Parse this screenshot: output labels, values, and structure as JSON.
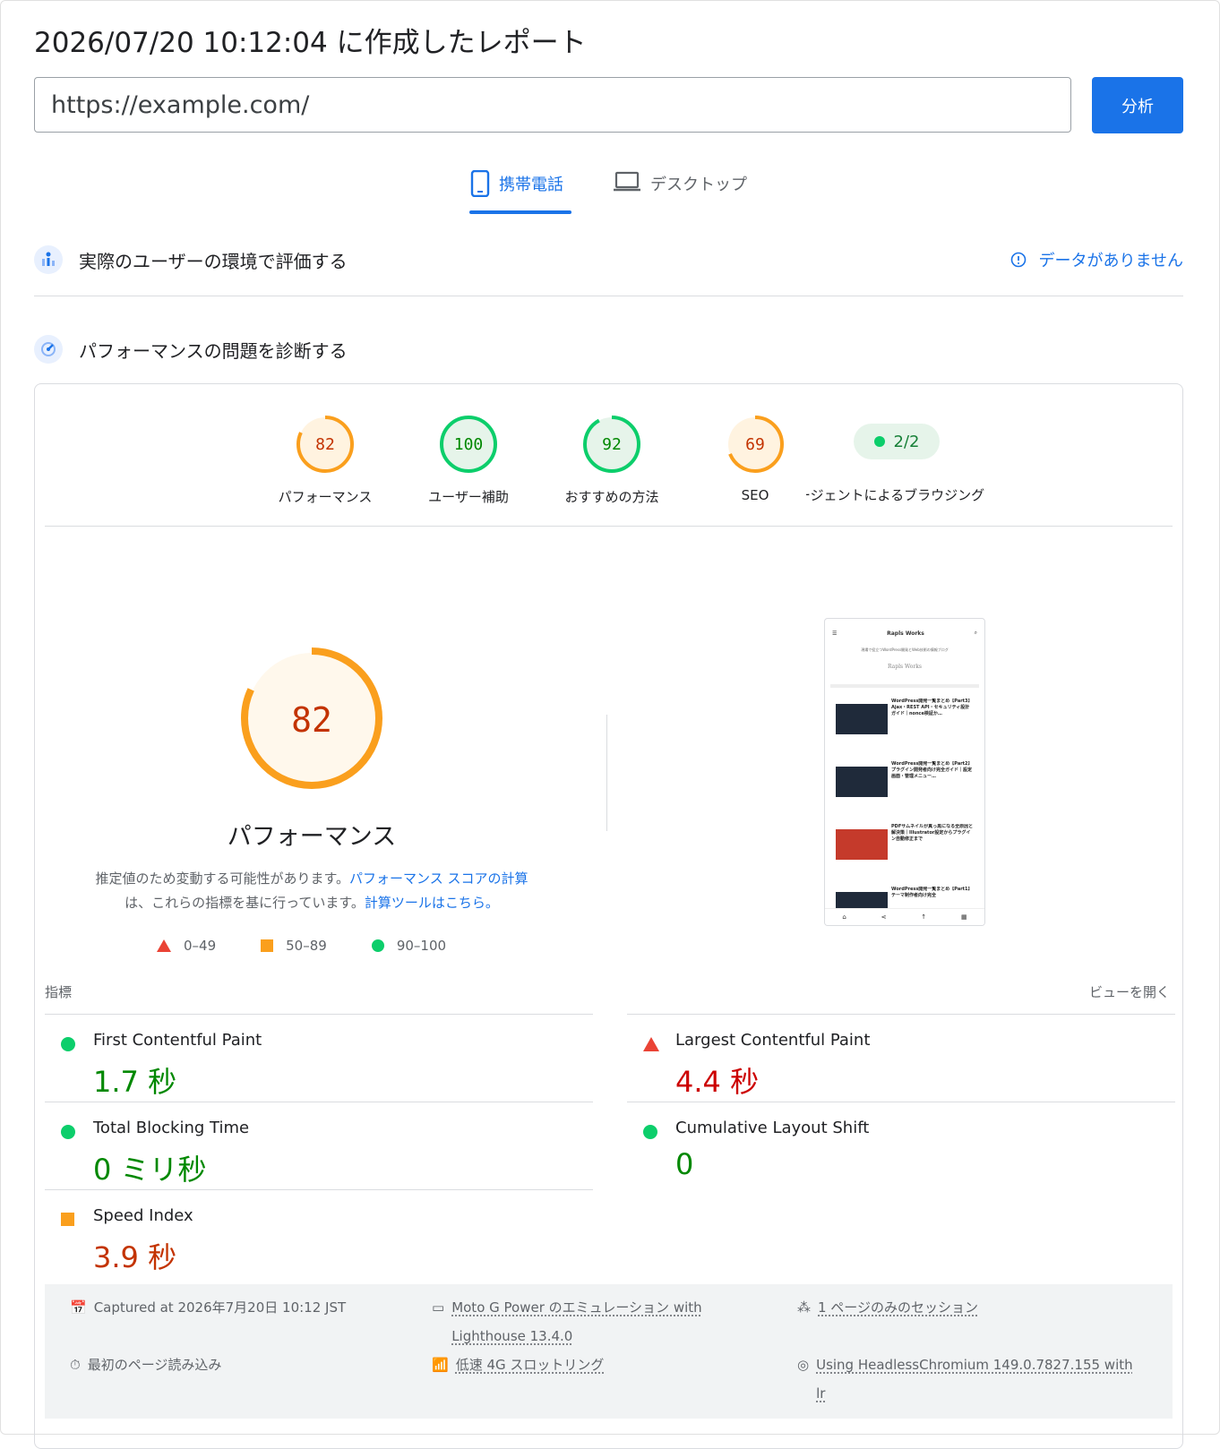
{
  "header": {
    "title": "2026/07/20 10:12:04 に作成したレポート"
  },
  "search": {
    "value": "https://example.com/",
    "analyze_label": "分析"
  },
  "tabs": [
    {
      "label": "携帯電話",
      "icon": "phone-icon"
    },
    {
      "label": "デスクトップ",
      "icon": "laptop-icon"
    }
  ],
  "field_data": {
    "title": "実際のユーザーの環境で評価する",
    "status": "データがありません",
    "icon": "users-chart-icon"
  },
  "diagnose": {
    "title": "パフォーマンスの問題を診断する",
    "icon": "gauge-icon"
  },
  "categories": [
    {
      "label": "パフォーマンス",
      "score": 82,
      "rating": "average"
    },
    {
      "label": "ユーザー補助",
      "score": 100,
      "rating": "pass"
    },
    {
      "label": "おすすめの方法",
      "score": 92,
      "rating": "pass"
    },
    {
      "label": "SEO",
      "score": 69,
      "rating": "average"
    }
  ],
  "agent": {
    "value": "2/2",
    "label": "エージェントによるブラウジング"
  },
  "performance": {
    "score": 82,
    "title": "パフォーマンス",
    "note_text_1": "推定値のため変動する可能性があります。",
    "note_link_1": "パフォーマンス スコアの計算",
    "note_text_2": "は、これらの指標を基に行っています。",
    "note_link_2": "計算ツールはこちら。"
  },
  "legend": [
    {
      "range": "0–49",
      "color": "#ea4335",
      "shape": "triangle"
    },
    {
      "range": "50–89",
      "color": "#fa9f1d",
      "shape": "square"
    },
    {
      "range": "90–100",
      "color": "#0cce6b",
      "shape": "circle"
    }
  ],
  "metrics_header": {
    "label": "指標",
    "expand": "ビューを開く"
  },
  "metrics": [
    {
      "name": "First Contentful Paint",
      "value": "1.7 秒",
      "rating": "pass"
    },
    {
      "name": "Largest Contentful Paint",
      "value": "4.4 秒",
      "rating": "fail"
    },
    {
      "name": "Total Blocking Time",
      "value": "0 ミリ秒",
      "rating": "pass"
    },
    {
      "name": "Cumulative Layout Shift",
      "value": "0",
      "rating": "pass"
    },
    {
      "name": "Speed Index",
      "value": "3.9 秒",
      "rating": "average"
    }
  ],
  "footer": {
    "captured": "Captured at 2026年7月20日 10:12 JST",
    "device_1": "Moto G Power のエミュレーション with",
    "device_2": "Lighthouse 13.4.0",
    "session": "1 ページのみのセッション",
    "load": "最初のページ読み込み",
    "throttle": "低速 4G スロットリング",
    "browser_1": "Using HeadlessChromium 149.0.7827.155 with",
    "browser_2": "lr"
  },
  "screenshot": {
    "site": "Rapls Works",
    "tagline": "現場で役立つWordPress開発とWeb技術の情報ブログ",
    "logo": "Rapls Works",
    "posts": [
      {
        "title": "WordPress開発一覧まとめ【Part3】Ajax・REST API・セキュリティ設計ガイド｜nonce検証か…",
        "thumb": "#1f2a3a"
      },
      {
        "title": "WordPress開発一覧まとめ【Part2】プラグイン開発者向け完全ガイド｜設定画面・管理メニュー…",
        "thumb": "#1f2a3a"
      },
      {
        "title": "PDFサムネイルが真っ黒になる全原因と解決策｜Illustrator設定からプラグイン自動修正まで",
        "thumb": "#c53a2b"
      },
      {
        "title": "WordPress開発一覧まとめ【Part1】テーマ制作者向け完全",
        "thumb": "#1f2a3a"
      }
    ]
  },
  "colors": {
    "accent": "#1a73e8",
    "pass": "#0cce6b",
    "pass_text": "#008800",
    "average": "#fa9f1d",
    "average_text": "#c33300",
    "fail": "#ea4335",
    "fail_text": "#cc0000"
  }
}
